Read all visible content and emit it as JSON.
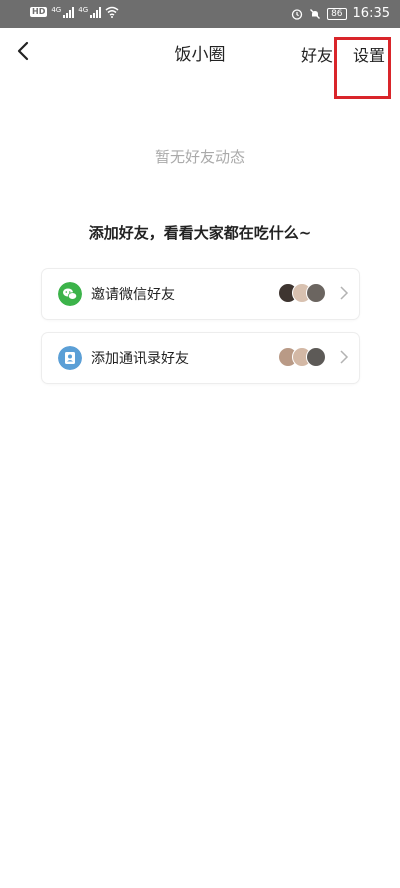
{
  "status_bar": {
    "chip_left": "HD",
    "network_1": "4G",
    "network_2": "4G",
    "battery": "86",
    "time": "16:35"
  },
  "nav": {
    "title": "饭小圈",
    "friends_label": "好友",
    "settings_label": "设置"
  },
  "empty_text": "暂无好友动态",
  "prompt_text": "添加好友，看看大家都在吃什么~",
  "invite_cards": [
    {
      "label": "邀请微信好友",
      "icon": "wechat-icon",
      "icon_color": "#3cb34a"
    },
    {
      "label": "添加通讯录好友",
      "icon": "contacts-icon",
      "icon_color": "#5b9fd6"
    }
  ],
  "colors": {
    "highlight": "#d9252a",
    "status_bar_bg": "#6e6e6e"
  }
}
